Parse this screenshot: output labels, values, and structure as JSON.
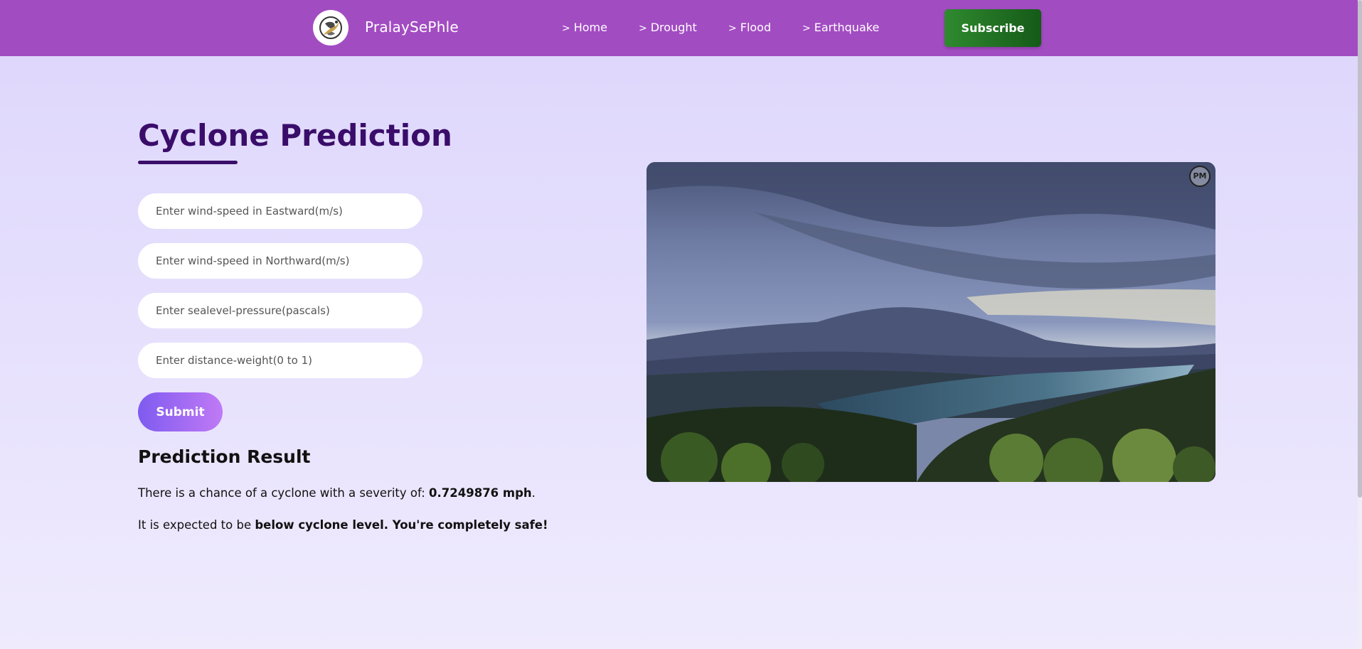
{
  "header": {
    "brand": "PralaySePhle",
    "nav": [
      {
        "label": "Home"
      },
      {
        "label": "Drought"
      },
      {
        "label": "Flood"
      },
      {
        "label": "Earthquake"
      }
    ],
    "nav_chevron": ">",
    "subscribe_label": "Subscribe"
  },
  "main": {
    "title": "Cyclone Prediction",
    "fields": [
      {
        "placeholder": "Enter wind-speed in Eastward(m/s)",
        "value": ""
      },
      {
        "placeholder": "Enter wind-speed in Northward(m/s)",
        "value": ""
      },
      {
        "placeholder": "Enter sealevel-pressure(pascals)",
        "value": ""
      },
      {
        "placeholder": "Enter distance-weight(0 to 1)",
        "value": ""
      }
    ],
    "submit_label": "Submit",
    "result": {
      "heading": "Prediction Result",
      "line1_prefix": "There is a chance of a cyclone with a severity of: ",
      "line1_value": "0.7249876 mph",
      "line1_suffix": ".",
      "line2_prefix": "It is expected to be ",
      "line2_value": "below cyclone level. You're completely safe!"
    }
  },
  "media": {
    "watermark": "PM"
  },
  "colors": {
    "navbar": "#a24cc2",
    "title": "#3a0d6a",
    "subscribe": "#2f8a2f",
    "submit_start": "#7f5bf0",
    "submit_end": "#c07af5"
  }
}
